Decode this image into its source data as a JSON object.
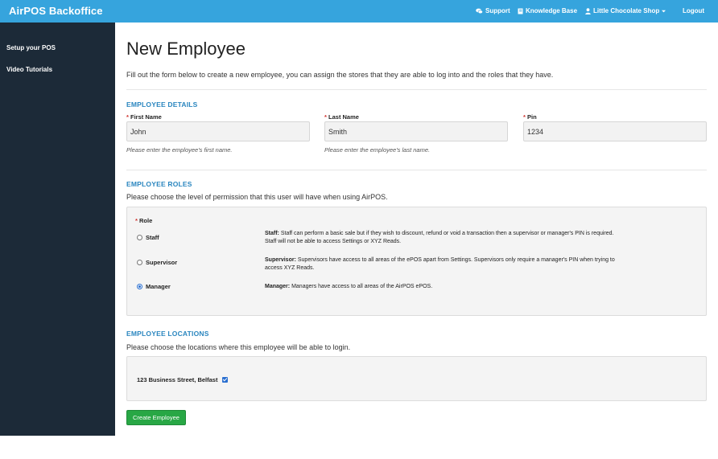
{
  "app": {
    "title": "AirPOS Backoffice"
  },
  "topnav": {
    "support": "Support",
    "knowledge_base": "Knowledge Base",
    "shop": "Little Chocolate Shop",
    "logout": "Logout"
  },
  "sidebar": {
    "items": [
      {
        "label": "Setup your POS"
      },
      {
        "label": "Video Tutorials"
      }
    ]
  },
  "page": {
    "title": "New Employee",
    "intro": "Fill out the form below to create a new employee, you can assign the stores that they are able to log into and the roles that they have."
  },
  "details": {
    "title": "EMPLOYEE DETAILS",
    "required_mark": "*",
    "first_name": {
      "label": "First Name",
      "value": "John",
      "help": "Please enter the employee's first name."
    },
    "last_name": {
      "label": "Last Name",
      "value": "Smith",
      "help": "Please enter the employee's last name."
    },
    "pin": {
      "label": "Pin",
      "value": "1234"
    }
  },
  "roles": {
    "title": "EMPLOYEE ROLES",
    "description": "Please choose the level of permission that this user will have when using AirPOS.",
    "role_label": "Role",
    "options": [
      {
        "label": "Staff",
        "desc_title": "Staff:",
        "desc_line1": "Staff can perform a basic sale but if they wish to discount, refund or void a transaction then a supervisor or manager's PIN is required.",
        "desc_line2": "Staff will not be able to access Settings or XYZ Reads.",
        "selected": false
      },
      {
        "label": "Supervisor",
        "desc_title": "Supervisor:",
        "desc_line1": "Supervisors have access to all areas of the ePOS apart from Settings. Supervisors only require a manager's PIN when trying to",
        "desc_line2": "access XYZ Reads.",
        "selected": false
      },
      {
        "label": "Manager",
        "desc_title": "Manager:",
        "desc_line1": "Managers have access to all areas of the AirPOS ePOS.",
        "desc_line2": "",
        "selected": true
      }
    ]
  },
  "locations": {
    "title": "EMPLOYEE LOCATIONS",
    "description": "Please choose the locations where this employee will be able to login.",
    "items": [
      {
        "label": "123 Business Street, Belfast",
        "checked": true
      }
    ]
  },
  "actions": {
    "create": "Create Employee"
  },
  "colors": {
    "topbar": "#36a4dd",
    "sidebar": "#1c2a38",
    "section_title": "#2a86bf",
    "required": "#d0312d",
    "primary_button": "#28a745",
    "selected_control": "#2a6fd0"
  }
}
